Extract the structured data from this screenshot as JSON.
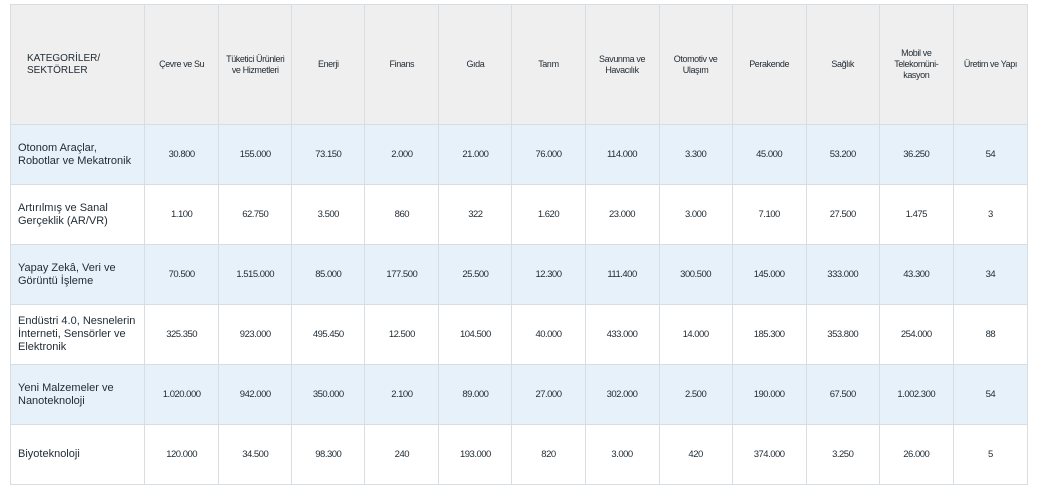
{
  "header": {
    "corner": "KATEGORİLER/\nSEKTÖRLER",
    "columns": [
      "Çevre ve Su",
      "Tüketici Ürünleri ve Hizmetleri",
      "Enerji",
      "Finans",
      "Gıda",
      "Tarım",
      "Savunma ve Havacılık",
      "Otomotiv ve Ulaşım",
      "Perakende",
      "Sağlık",
      "Mobil ve Telekomüni-kasyon",
      "Üretim ve Yapı"
    ]
  },
  "rows": [
    {
      "category": "Otonom Araçlar, Robotlar ve Mekatronik",
      "values": [
        "30.800",
        "155.000",
        "73.150",
        "2.000",
        "21.000",
        "76.000",
        "114.000",
        "3.300",
        "45.000",
        "53.200",
        "36.250",
        "54"
      ]
    },
    {
      "category": "Artırılmış ve Sanal Gerçeklik (AR/VR)",
      "values": [
        "1.100",
        "62.750",
        "3.500",
        "860",
        "322",
        "1.620",
        "23.000",
        "3.000",
        "7.100",
        "27.500",
        "1.475",
        "3"
      ]
    },
    {
      "category": "Yapay Zekâ, Veri ve Görüntü İşleme",
      "values": [
        "70.500",
        "1.515.000",
        "85.000",
        "177.500",
        "25.500",
        "12.300",
        "111.400",
        "300.500",
        "145.000",
        "333.000",
        "43.300",
        "34"
      ]
    },
    {
      "category": "Endüstri 4.0, Nesnelerin İnterneti, Sensörler ve Elektronik",
      "values": [
        "325.350",
        "923.000",
        "495.450",
        "12.500",
        "104.500",
        "40.000",
        "433.000",
        "14.000",
        "185.300",
        "353.800",
        "254.000",
        "88"
      ]
    },
    {
      "category": "Yeni Malzemeler ve Nanoteknoloji",
      "values": [
        "1.020.000",
        "942.000",
        "350.000",
        "2.100",
        "89.000",
        "27.000",
        "302.000",
        "2.500",
        "190.000",
        "67.500",
        "1.002.300",
        "54"
      ]
    },
    {
      "category": "Biyoteknoloji",
      "values": [
        "120.000",
        "34.500",
        "98.300",
        "240",
        "193.000",
        "820",
        "3.000",
        "420",
        "374.000",
        "3.250",
        "26.000",
        "5"
      ]
    }
  ]
}
